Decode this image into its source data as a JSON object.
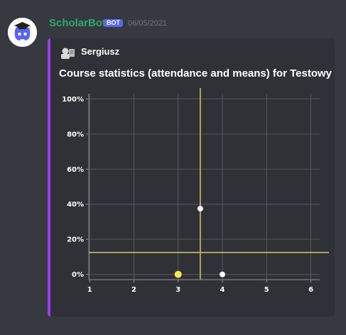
{
  "message": {
    "author": "ScholarBot",
    "badge": "BOT",
    "timestamp": "06/05/2021",
    "avatar_icon": "discord-graduate-icon"
  },
  "embed": {
    "accent_color": "#9b3df6",
    "author_icon": "student-icon",
    "author_name": "Sergiusz",
    "title": "Course statistics (attendance and means) for Testowy"
  },
  "chart_data": {
    "type": "scatter",
    "x_ticks": [
      "1",
      "2",
      "3",
      "4",
      "5",
      "6"
    ],
    "y_ticks": [
      "0%",
      "20%",
      "40%",
      "60%",
      "80%",
      "100%"
    ],
    "xlim": [
      0.98,
      6.2
    ],
    "ylim": [
      -0.03,
      1.03
    ],
    "grid": true,
    "points": [
      {
        "x": 3,
        "y": 0.0,
        "color": "#f5e94c",
        "highlight": true
      },
      {
        "x": 3.5,
        "y": 0.375,
        "color": "#ffffff"
      },
      {
        "x": 4,
        "y": 0.0,
        "color": "#ffffff"
      }
    ],
    "reference_lines": {
      "vertical_x": 3.5,
      "horizontal_y": 0.125,
      "color": "#c9c16a"
    }
  }
}
